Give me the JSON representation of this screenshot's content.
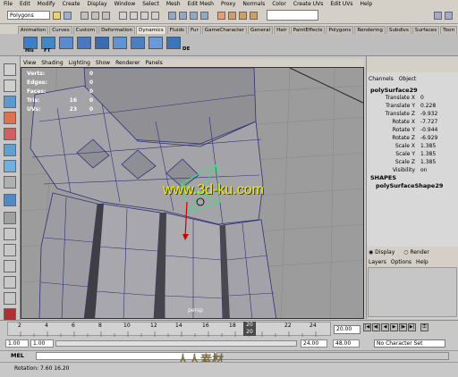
{
  "menubar": [
    "File",
    "Edit",
    "Modify",
    "Create",
    "Display",
    "Window",
    "Select",
    "Mesh",
    "Edit Mesh",
    "Proxy",
    "Normals",
    "Color",
    "Create UVs",
    "Edit UVs",
    "Help"
  ],
  "statusline": {
    "mode": "Polygons"
  },
  "shelf_tabs": [
    "Animation",
    "Curves",
    "Custom",
    "Deformation",
    "Dynamics",
    "Fluids",
    "Fur",
    "GameCharacter",
    "General",
    "Hair",
    "PaintEffects",
    "Polygons",
    "Rendering",
    "Subdivs",
    "Surfaces",
    "Toon"
  ],
  "shelf_active_tab": "Dynamics",
  "shelf_labels": [
    "His",
    "FT",
    "DE"
  ],
  "panel_menu": [
    "View",
    "Shading",
    "Lighting",
    "Show",
    "Renderer",
    "Panels"
  ],
  "hud": {
    "rows": [
      {
        "label": "Verts:",
        "v1": "",
        "v2": "0"
      },
      {
        "label": "Edges:",
        "v1": "",
        "v2": "0"
      },
      {
        "label": "Faces:",
        "v1": "",
        "v2": "0"
      },
      {
        "label": "Tris:",
        "v1": "16",
        "v2": "0"
      },
      {
        "label": "UVs:",
        "v1": "23",
        "v2": "0"
      }
    ]
  },
  "viewport": {
    "camera": "persp",
    "watermark": "www.3d-ku.com"
  },
  "channel_box": {
    "menu": [
      "Channels",
      "Object"
    ],
    "object_name": "polySurface29",
    "attributes": [
      {
        "name": "Translate X",
        "value": "0"
      },
      {
        "name": "Translate Y",
        "value": "0.228"
      },
      {
        "name": "Translate Z",
        "value": "-9.932"
      },
      {
        "name": "Rotate X",
        "value": "-7.727"
      },
      {
        "name": "Rotate Y",
        "value": "-0.944"
      },
      {
        "name": "Rotate Z",
        "value": "-6.929"
      },
      {
        "name": "Scale X",
        "value": "1.385"
      },
      {
        "name": "Scale Y",
        "value": "1.385"
      },
      {
        "name": "Scale Z",
        "value": "1.385"
      },
      {
        "name": "Visibility",
        "value": "on"
      }
    ],
    "shapes_header": "SHAPES",
    "shape_name": "polySurfaceShape29"
  },
  "layers": {
    "display": "Display",
    "render": "Render",
    "menu": [
      "Layers",
      "Options",
      "Help"
    ]
  },
  "timeline": {
    "ticks": [
      "2",
      "4",
      "6",
      "8",
      "10",
      "12",
      "14",
      "16",
      "18",
      "",
      "22",
      "24"
    ],
    "current_frame": "20",
    "current_frame_sub": "20",
    "current_time": "20.00"
  },
  "range": {
    "start": "1.00",
    "start2": "1.00",
    "end": "24.00",
    "end2": "48.00",
    "character_set": "No Character Set"
  },
  "command": {
    "label": "MEL"
  },
  "help": {
    "text": "Rotation:  7.60        16.20"
  },
  "site_watermark": "人人素材"
}
